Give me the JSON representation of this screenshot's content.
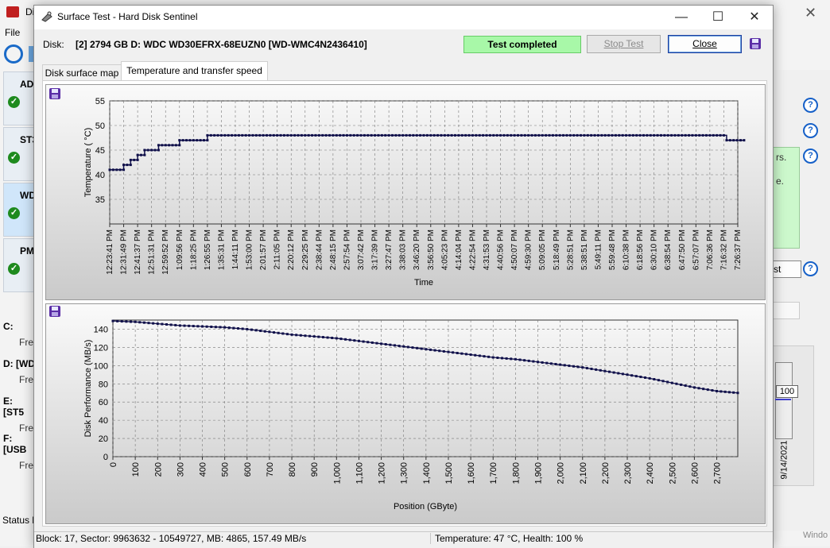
{
  "background_window": {
    "title": "Di",
    "menu_file": "File",
    "disks": [
      {
        "label": "AD"
      },
      {
        "label": "ST3"
      },
      {
        "label": "WD"
      },
      {
        "label": "PM"
      }
    ],
    "partitions": [
      {
        "label": "C:",
        "free": "Fre"
      },
      {
        "label": "D: [WD",
        "free": "Fre"
      },
      {
        "label": "E: [ST5",
        "free": "Fre"
      },
      {
        "label": "F: [USB",
        "free": "Fre"
      }
    ],
    "status_label": "Status l",
    "right_text_line1": "rs.",
    "right_text_line2": "e.",
    "right_button": "st",
    "chart_value_box": "100",
    "chart_date": "9/14/2021",
    "watermark": "Windo"
  },
  "dialog": {
    "title": "Surface Test - Hard Disk Sentinel",
    "disk_label": "Disk:",
    "disk_value": "[2] 2794 GB D: WDC WD30EFRX-68EUZN0 [WD-WMC4N2436410]",
    "status": "Test completed",
    "stop_button": "Stop Test",
    "close_button": "Close",
    "tabs": [
      "Disk surface map",
      "Temperature and transfer speed"
    ],
    "status_bar_left": "Block: 17, Sector: 9963632 - 10549727, MB: 4865, 157.49 MB/s",
    "status_bar_right": "Temperature: 47  °C,  Health: 100 %",
    "colors": {
      "status_ok": "#a8f8a8",
      "series": "#10104a",
      "accent": "#1e3f9e"
    }
  },
  "chart_data": [
    {
      "type": "line",
      "xlabel": "Time",
      "ylabel": "Temperature ( °C)",
      "ylim": [
        30,
        55
      ],
      "yticks": [
        35,
        40,
        45,
        50,
        55
      ],
      "x_tick_labels": [
        "12:23:41 PM",
        "12:31:49 PM",
        "12:41:37 PM",
        "12:51:31 PM",
        "12:59:52 PM",
        "1:09:56 PM",
        "1:18:25 PM",
        "1:26:55 PM",
        "1:35:31 PM",
        "1:44:11 PM",
        "1:53:00 PM",
        "2:01:57 PM",
        "2:11:05 PM",
        "2:20:12 PM",
        "2:29:25 PM",
        "2:38:44 PM",
        "2:48:15 PM",
        "2:57:54 PM",
        "3:07:42 PM",
        "3:17:39 PM",
        "3:27:47 PM",
        "3:38:03 PM",
        "3:46:20 PM",
        "3:56:50 PM",
        "4:05:23 PM",
        "4:14:04 PM",
        "4:22:54 PM",
        "4:31:53 PM",
        "4:40:56 PM",
        "4:50:07 PM",
        "4:59:30 PM",
        "5:09:05 PM",
        "5:18:49 PM",
        "5:28:51 PM",
        "5:38:51 PM",
        "5:49:11 PM",
        "5:59:48 PM",
        "6:10:38 PM",
        "6:18:56 PM",
        "6:30:10 PM",
        "6:38:54 PM",
        "6:47:50 PM",
        "6:57:07 PM",
        "7:06:36 PM",
        "7:16:32 PM",
        "7:26:37 PM"
      ],
      "grid": true,
      "temperature_steps": [
        {
          "from_tick": 0,
          "to_tick": 1,
          "value": 41
        },
        {
          "from_tick": 1,
          "to_tick": 1.5,
          "value": 42
        },
        {
          "from_tick": 1.5,
          "to_tick": 2,
          "value": 43
        },
        {
          "from_tick": 2,
          "to_tick": 2.5,
          "value": 44
        },
        {
          "from_tick": 2.5,
          "to_tick": 3.5,
          "value": 45
        },
        {
          "from_tick": 3.5,
          "to_tick": 5,
          "value": 46
        },
        {
          "from_tick": 5,
          "to_tick": 7,
          "value": 47
        },
        {
          "from_tick": 7,
          "to_tick": 44.2,
          "value": 48
        },
        {
          "from_tick": 44.2,
          "to_tick": 45.5,
          "value": 47
        }
      ]
    },
    {
      "type": "scatter",
      "xlabel": "Position (GByte)",
      "ylabel": "Disk Performance (MB/s)",
      "xlim": [
        0,
        2794
      ],
      "ylim": [
        0,
        150
      ],
      "xticks": [
        "0",
        "100",
        "200",
        "300",
        "400",
        "500",
        "600",
        "700",
        "800",
        "900",
        "1,000",
        "1,100",
        "1,200",
        "1,300",
        "1,400",
        "1,500",
        "1,600",
        "1,700",
        "1,800",
        "1,900",
        "2,000",
        "2,100",
        "2,200",
        "2,300",
        "2,400",
        "2,500",
        "2,600",
        "2,700"
      ],
      "yticks": [
        0,
        20,
        40,
        60,
        80,
        100,
        120,
        140
      ],
      "grid": true,
      "x": [
        0,
        100,
        200,
        300,
        400,
        500,
        600,
        700,
        800,
        900,
        1000,
        1100,
        1200,
        1300,
        1400,
        1500,
        1600,
        1700,
        1800,
        1900,
        2000,
        2100,
        2200,
        2300,
        2400,
        2500,
        2600,
        2700,
        2794
      ],
      "values": [
        149,
        148,
        146,
        144,
        143,
        142,
        140,
        137,
        134,
        132,
        130,
        127,
        124,
        121,
        118,
        115,
        112,
        109,
        107,
        104,
        101,
        98,
        94,
        90,
        86,
        81,
        76,
        72,
        70
      ]
    }
  ]
}
